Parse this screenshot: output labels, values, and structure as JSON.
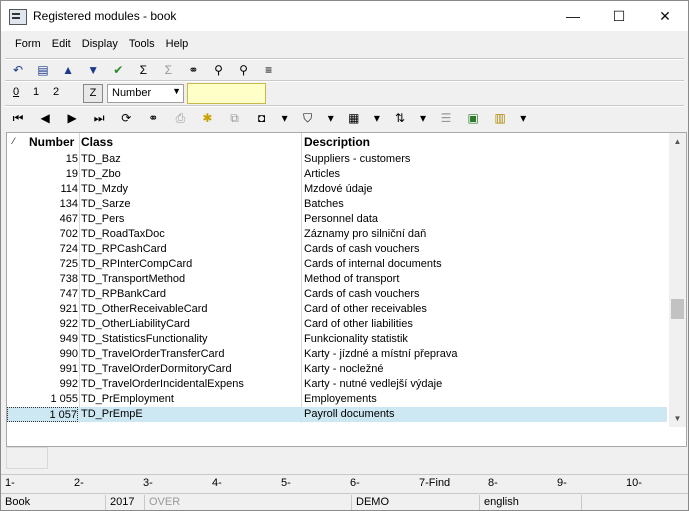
{
  "window": {
    "title": "Registered modules - book",
    "minimize": "—",
    "maximize": "☐",
    "close": "✕"
  },
  "menu": [
    "Form",
    "Edit",
    "Display",
    "Tools",
    "Help"
  ],
  "tabs": [
    "0",
    "1",
    "2"
  ],
  "toolbar2": {
    "z_label": "Z",
    "sort_field": "Number",
    "search_value": ""
  },
  "grid": {
    "headers": {
      "number": "Number",
      "class": "Class",
      "description": "Description"
    },
    "rows": [
      {
        "number": "15",
        "class": "TD_Baz",
        "description": "Suppliers - customers"
      },
      {
        "number": "19",
        "class": "TD_Zbo",
        "description": "Articles"
      },
      {
        "number": "114",
        "class": "TD_Mzdy",
        "description": "Mzdové údaje"
      },
      {
        "number": "134",
        "class": "TD_Sarze",
        "description": "Batches"
      },
      {
        "number": "467",
        "class": "TD_Pers",
        "description": "Personnel data"
      },
      {
        "number": "702",
        "class": "TD_RoadTaxDoc",
        "description": "Záznamy pro silniční daň"
      },
      {
        "number": "724",
        "class": "TD_RPCashCard",
        "description": "Cards of cash vouchers"
      },
      {
        "number": "725",
        "class": "TD_RPInterCompCard",
        "description": "Cards of internal documents"
      },
      {
        "number": "738",
        "class": "TD_TransportMethod",
        "description": "Method of transport"
      },
      {
        "number": "747",
        "class": "TD_RPBankCard",
        "description": "Cards of cash vouchers"
      },
      {
        "number": "921",
        "class": "TD_OtherReceivableCard",
        "description": "Card of other receivables"
      },
      {
        "number": "922",
        "class": "TD_OtherLiabilityCard",
        "description": "Card of other liabilities"
      },
      {
        "number": "949",
        "class": "TD_StatisticsFunctionality",
        "description": "Funkcionality statistik"
      },
      {
        "number": "990",
        "class": "TD_TravelOrderTransferCard",
        "description": "Karty - jízdné a místní přeprava"
      },
      {
        "number": "991",
        "class": "TD_TravelOrderDormitoryCard",
        "description": "Karty - nocležné"
      },
      {
        "number": "992",
        "class": "TD_TravelOrderIncidentalExpens",
        "description": "Karty - nutné vedlejší výdaje"
      },
      {
        "number": "1 055",
        "class": "TD_PrEmployment",
        "description": "Employements"
      },
      {
        "number": "1 057",
        "class": "TD_PrEmpE",
        "description": "Payroll documents"
      }
    ]
  },
  "function_keys": [
    "1-",
    "2-",
    "3-",
    "4-",
    "5-",
    "6-",
    "7-Find",
    "8-",
    "9-",
    "10-"
  ],
  "statusbar": {
    "db": "Book",
    "year": "2017",
    "mode": "OVER",
    "user": "DEMO",
    "language": "english"
  }
}
